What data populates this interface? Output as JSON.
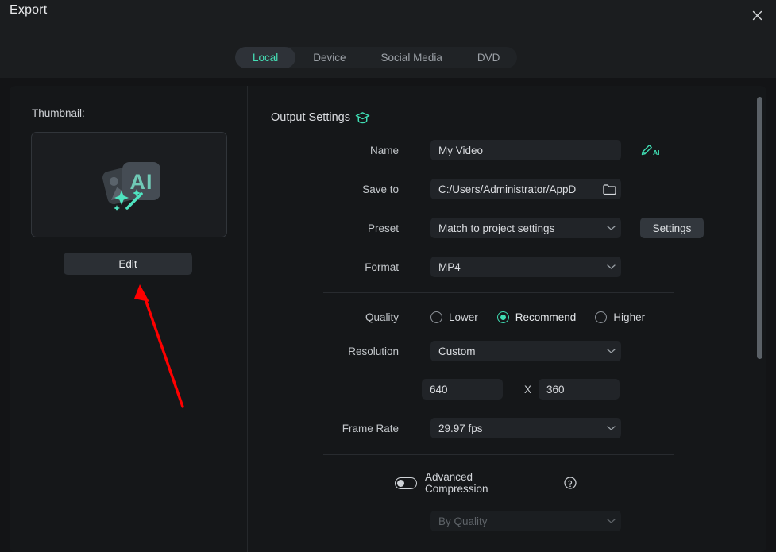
{
  "window": {
    "title": "Export",
    "close_icon": "close-icon"
  },
  "tabs": [
    {
      "label": "Local",
      "active": true
    },
    {
      "label": "Device",
      "active": false
    },
    {
      "label": "Social Media",
      "active": false
    },
    {
      "label": "DVD",
      "active": false
    }
  ],
  "left_panel": {
    "thumbnail_label": "Thumbnail:",
    "thumbnail_placeholder_icon": "ai-image-placeholder-icon",
    "edit_label": "Edit",
    "annotation_arrow": "red-arrow-annotation"
  },
  "output_settings": {
    "section_title": "Output Settings",
    "section_icon": "graduation-cap-icon",
    "name": {
      "label": "Name",
      "value": "My Video",
      "placeholder": "My Video",
      "trailing_icon": "ai-pen-icon",
      "trailing_icon_label": "AI"
    },
    "save_to": {
      "label": "Save to",
      "value": "C:/Users/Administrator/AppD",
      "trailing_icon": "folder-icon"
    },
    "preset": {
      "label": "Preset",
      "value": "Match to project settings",
      "button_label": "Settings"
    },
    "format": {
      "label": "Format",
      "value": "MP4"
    },
    "quality": {
      "label": "Quality",
      "options": [
        {
          "label": "Lower",
          "selected": false
        },
        {
          "label": "Recommend",
          "selected": true
        },
        {
          "label": "Higher",
          "selected": false
        }
      ]
    },
    "resolution": {
      "label": "Resolution",
      "value": "Custom",
      "width": "640",
      "height": "360",
      "separator": "X"
    },
    "frame_rate": {
      "label": "Frame Rate",
      "value": "29.97 fps"
    },
    "advanced_compression": {
      "label": "Advanced Compression",
      "enabled": false,
      "help_icon": "help-circle-icon",
      "mode_value": "By Quality"
    }
  },
  "colors": {
    "accent": "#3fdcb2",
    "window_bg": "#1b1d1f",
    "panel_bg": "#151719",
    "field_bg": "#212428",
    "annotation_red": "#ff0000"
  }
}
